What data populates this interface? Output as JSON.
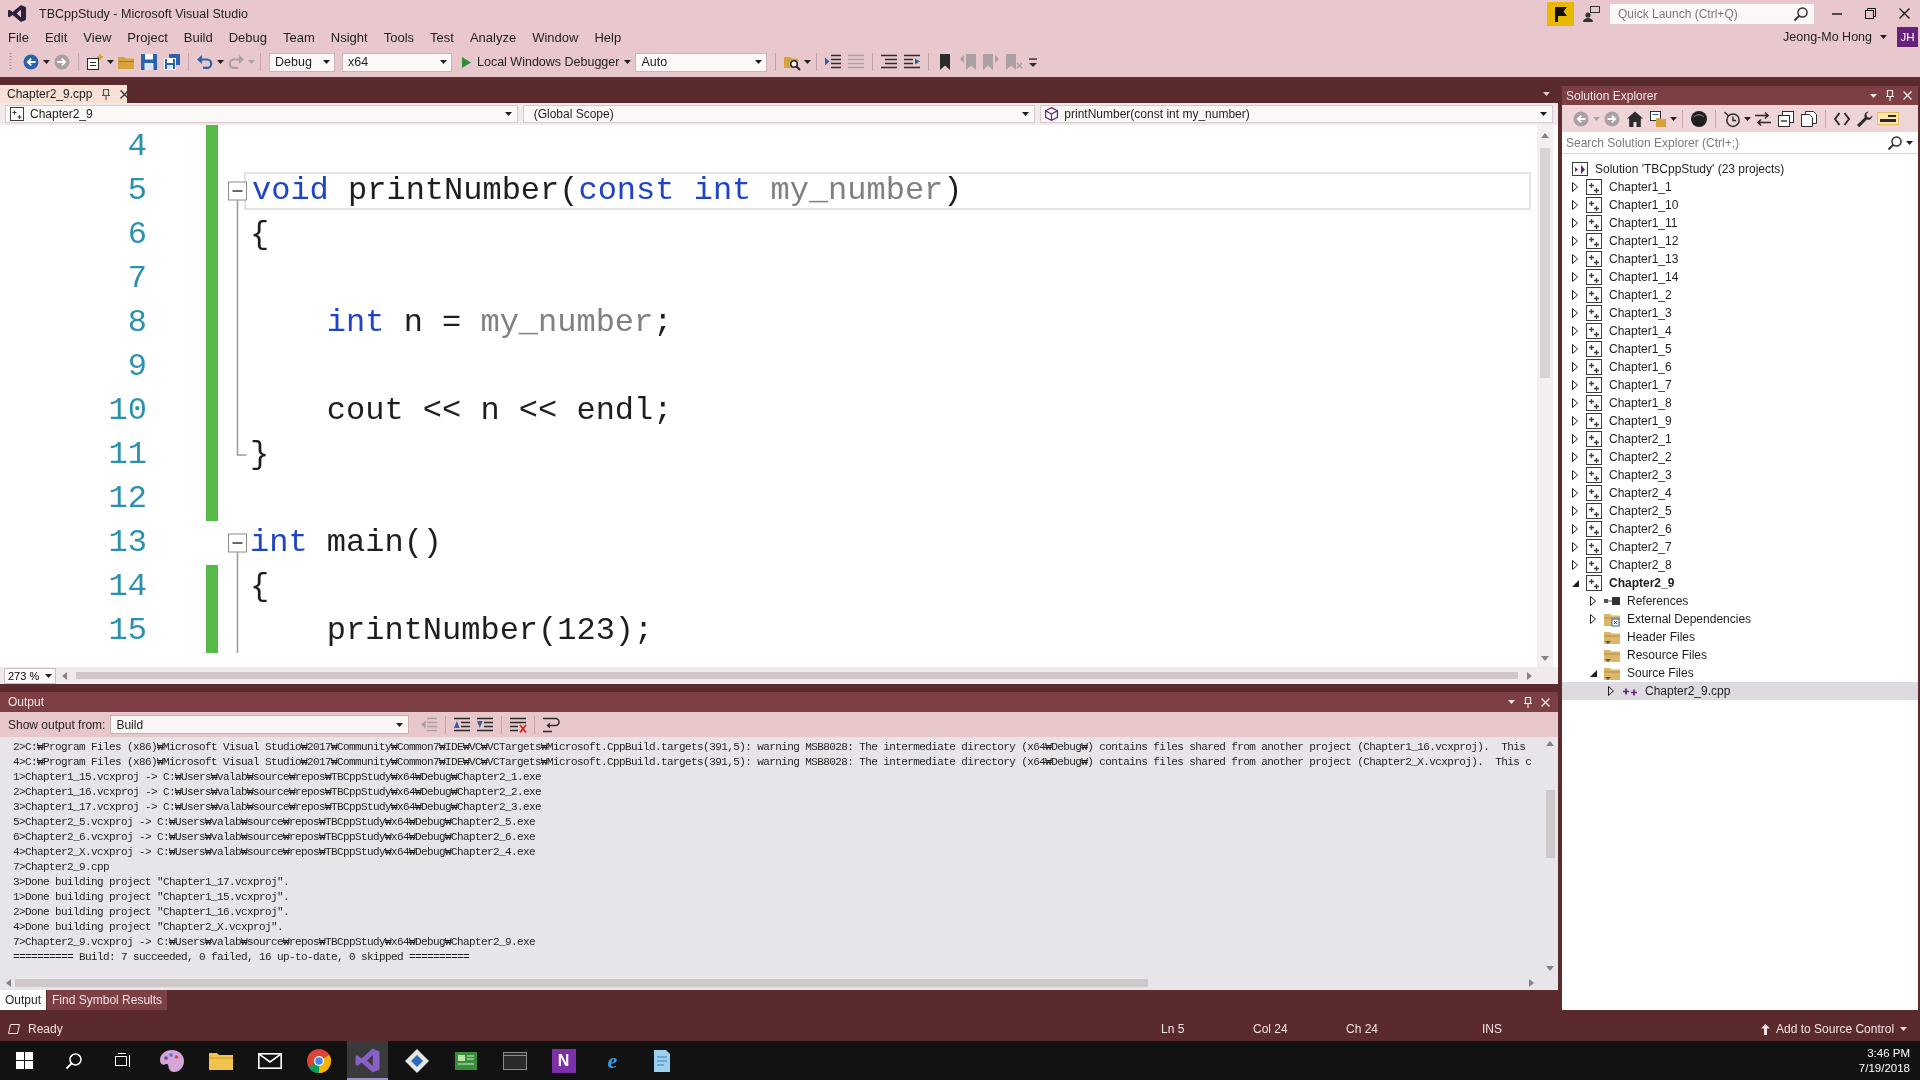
{
  "window": {
    "title": "TBCppStudy - Microsoft Visual Studio",
    "quick_launch": {
      "placeholder": "Quick Launch (Ctrl+Q)"
    },
    "user": {
      "name": "Jeong-Mo Hong",
      "initials": "JH"
    }
  },
  "menu": [
    "File",
    "Edit",
    "View",
    "Project",
    "Build",
    "Debug",
    "Team",
    "Nsight",
    "Tools",
    "Test",
    "Analyze",
    "Window",
    "Help"
  ],
  "toolbar": {
    "groups": [
      [
        {
          "kind": "back",
          "disabled": false
        },
        {
          "kind": "forward",
          "disabled": true
        }
      ],
      [
        {
          "kind": "new-project",
          "disabled": false
        },
        {
          "kind": "open-file",
          "disabled": false
        },
        {
          "kind": "save",
          "disabled": false
        },
        {
          "kind": "save-all",
          "disabled": false
        }
      ],
      [
        {
          "kind": "undo",
          "disabled": false
        },
        {
          "kind": "redo",
          "disabled": true
        }
      ],
      [
        {
          "kind": "combo",
          "value": "Debug"
        },
        {
          "kind": "combo",
          "value": "x64"
        },
        {
          "kind": "run",
          "label": "Local Windows Debugger"
        },
        {
          "kind": "combo",
          "value": "Auto"
        }
      ],
      [
        {
          "kind": "find-in-files",
          "disabled": false
        }
      ],
      [
        {
          "kind": "go-to-line",
          "disabled": false
        },
        {
          "kind": "line-list",
          "disabled": true
        }
      ],
      [
        {
          "kind": "comment",
          "disabled": false
        },
        {
          "kind": "uncomment",
          "disabled": false
        }
      ],
      [
        {
          "kind": "bookmark",
          "disabled": false
        },
        {
          "kind": "bookmark-previous",
          "disabled": true
        },
        {
          "kind": "bookmark-next",
          "disabled": true
        },
        {
          "kind": "bookmark-clear",
          "disabled": true
        },
        {
          "kind": "overflow",
          "disabled": false
        }
      ]
    ]
  },
  "editor": {
    "tabs": [
      {
        "label": "Chapter2_9.cpp",
        "selected": true
      }
    ],
    "navigation": {
      "project": "Chapter2_9",
      "scope": "(Global Scope)",
      "member": "printNumber(const int my_number)"
    },
    "zoom": "273 %",
    "lines": [
      {
        "number": "4",
        "kind": "plain",
        "changed": true,
        "current": false
      },
      {
        "number": "5",
        "kind": "header",
        "expanded": true,
        "tokens": [
          {
            "kind": "keyword",
            "text": "void"
          },
          {
            "kind": "plain",
            "text": " printNumber("
          },
          {
            "kind": "keyword",
            "text": "const int"
          },
          {
            "kind": "parameter",
            "text": " my_number"
          },
          {
            "kind": "plain",
            "text": ")"
          }
        ],
        "changed": true,
        "current": true
      },
      {
        "number": "6",
        "kind": "body",
        "tokens": [
          {
            "kind": "plain",
            "text": "{"
          }
        ],
        "changed": true,
        "current": false
      },
      {
        "number": "7",
        "kind": "body",
        "changed": true,
        "current": false
      },
      {
        "number": "8",
        "kind": "body",
        "tokens": [
          {
            "kind": "keyword",
            "text": "    int"
          },
          {
            "kind": "plain",
            "text": " n = "
          },
          {
            "kind": "parameter",
            "text": "my_number"
          },
          {
            "kind": "plain",
            "text": ";"
          }
        ],
        "changed": true,
        "current": false
      },
      {
        "number": "9",
        "kind": "body",
        "changed": true,
        "current": false
      },
      {
        "number": "10",
        "kind": "body",
        "tokens": [
          {
            "kind": "plain",
            "text": "    cout << n << endl;"
          }
        ],
        "changed": true,
        "current": false
      },
      {
        "number": "11",
        "kind": "footer",
        "tokens": [
          {
            "kind": "plain",
            "text": "}"
          }
        ],
        "changed": true,
        "current": false
      },
      {
        "number": "12",
        "kind": "plain",
        "changed": true,
        "current": false
      },
      {
        "number": "13",
        "kind": "header",
        "expanded": true,
        "tokens": [
          {
            "kind": "keyword",
            "text": "int"
          },
          {
            "kind": "plain",
            "text": " main()"
          }
        ],
        "changed": false,
        "current": false
      },
      {
        "number": "14",
        "kind": "body",
        "tokens": [
          {
            "kind": "plain",
            "text": "{"
          }
        ],
        "changed": true,
        "current": false
      },
      {
        "number": "15",
        "kind": "body",
        "tokens": [
          {
            "kind": "plain",
            "text": "    printNumber(123);"
          }
        ],
        "changed": true,
        "current": false
      }
    ]
  },
  "output": {
    "title": "Output",
    "source_label": "Show output from:",
    "source": "Build",
    "toolbar": [
      [
        {
          "kind": "previous-message",
          "disabled": true
        }
      ],
      [
        {
          "kind": "find-previous",
          "disabled": false
        },
        {
          "kind": "find-next",
          "disabled": false
        }
      ],
      [
        {
          "kind": "clear-all",
          "disabled": false
        }
      ],
      [
        {
          "kind": "word-wrap",
          "disabled": false
        }
      ]
    ],
    "lines": [
      "2>C:₩Program Files (x86)₩Microsoft Visual Studio₩2017₩Community₩Common7₩IDE₩VC₩VCTargets₩Microsoft.CppBuild.targets(391,5): warning MSB8028: The intermediate directory (x64₩Debug₩) contains files shared from another project (Chapter1_16.vcxproj).  This",
      "4>C:₩Program Files (x86)₩Microsoft Visual Studio₩2017₩Community₩Common7₩IDE₩VC₩VCTargets₩Microsoft.CppBuild.targets(391,5): warning MSB8028: The intermediate directory (x64₩Debug₩) contains files shared from another project (Chapter2_X.vcxproj).  This c",
      "1>Chapter1_15.vcxproj -> C:₩Users₩valab₩source₩repos₩TBCppStudy₩x64₩Debug₩Chapter2_1.exe",
      "2>Chapter1_16.vcxproj -> C:₩Users₩valab₩source₩repos₩TBCppStudy₩x64₩Debug₩Chapter2_2.exe",
      "3>Chapter1_17.vcxproj -> C:₩Users₩valab₩source₩repos₩TBCppStudy₩x64₩Debug₩Chapter2_3.exe",
      "5>Chapter2_5.vcxproj -> C:₩Users₩valab₩source₩repos₩TBCppStudy₩x64₩Debug₩Chapter2_5.exe",
      "6>Chapter2_6.vcxproj -> C:₩Users₩valab₩source₩repos₩TBCppStudy₩x64₩Debug₩Chapter2_6.exe",
      "4>Chapter2_X.vcxproj -> C:₩Users₩valab₩source₩repos₩TBCppStudy₩x64₩Debug₩Chapter2_4.exe",
      "7>Chapter2_9.cpp",
      "3>Done building project \"Chapter1_17.vcxproj\".",
      "1>Done building project \"Chapter1_15.vcxproj\".",
      "2>Done building project \"Chapter1_16.vcxproj\".",
      "4>Done building project \"Chapter2_X.vcxproj\".",
      "7>Chapter2_9.vcxproj -> C:₩Users₩valab₩source₩repos₩TBCppStudy₩x64₩Debug₩Chapter2_9.exe",
      "========== Build: 7 succeeded, 0 failed, 16 up-to-date, 0 skipped =========="
    ],
    "tabs": [
      {
        "label": "Output",
        "selected": true
      },
      {
        "label": "Find Symbol Results",
        "selected": false
      }
    ]
  },
  "solution_explorer": {
    "title": "Solution Explorer",
    "toolbar": [
      [
        {
          "kind": "back",
          "disabled": true,
          "on": false
        },
        {
          "kind": "forward",
          "disabled": true,
          "on": false
        },
        {
          "kind": "home",
          "disabled": false,
          "on": false
        },
        {
          "kind": "switch-views",
          "disabled": false,
          "on": false
        }
      ],
      [
        {
          "kind": "pending-changes",
          "disabled": false,
          "on": false
        }
      ],
      [
        {
          "kind": "history",
          "disabled": false,
          "on": false
        },
        {
          "kind": "sync",
          "disabled": false,
          "on": false
        },
        {
          "kind": "collapse-all",
          "disabled": false,
          "on": false
        },
        {
          "kind": "show-all-files",
          "disabled": false,
          "on": false
        }
      ],
      [
        {
          "kind": "code-view",
          "disabled": false,
          "on": false
        },
        {
          "kind": "properties",
          "disabled": false,
          "on": false
        },
        {
          "kind": "preview",
          "disabled": false,
          "on": true
        }
      ]
    ],
    "search": {
      "placeholder": "Search Solution Explorer (Ctrl+;)"
    },
    "tree": [
      {
        "label": "Solution 'TBCppStudy' (23 projects)",
        "kind": "solution",
        "selected": false,
        "children": [
          {
            "label": "Chapter1_1",
            "kind": "project",
            "startup": false,
            "expanded": false,
            "selected": false
          },
          {
            "label": "Chapter1_10",
            "kind": "project",
            "startup": false,
            "expanded": false,
            "selected": false
          },
          {
            "label": "Chapter1_11",
            "kind": "project",
            "startup": false,
            "expanded": false,
            "selected": false
          },
          {
            "label": "Chapter1_12",
            "kind": "project",
            "startup": false,
            "expanded": false,
            "selected": false
          },
          {
            "label": "Chapter1_13",
            "kind": "project",
            "startup": false,
            "expanded": false,
            "selected": false
          },
          {
            "label": "Chapter1_14",
            "kind": "project",
            "startup": false,
            "expanded": false,
            "selected": false
          },
          {
            "label": "Chapter1_2",
            "kind": "project",
            "startup": false,
            "expanded": false,
            "selected": false
          },
          {
            "label": "Chapter1_3",
            "kind": "project",
            "startup": false,
            "expanded": false,
            "selected": false
          },
          {
            "label": "Chapter1_4",
            "kind": "project",
            "startup": false,
            "expanded": false,
            "selected": false
          },
          {
            "label": "Chapter1_5",
            "kind": "project",
            "startup": false,
            "expanded": false,
            "selected": false
          },
          {
            "label": "Chapter1_6",
            "kind": "project",
            "startup": false,
            "expanded": false,
            "selected": false
          },
          {
            "label": "Chapter1_7",
            "kind": "project",
            "startup": false,
            "expanded": false,
            "selected": false
          },
          {
            "label": "Chapter1_8",
            "kind": "project",
            "startup": false,
            "expanded": false,
            "selected": false
          },
          {
            "label": "Chapter1_9",
            "kind": "project",
            "startup": false,
            "expanded": false,
            "selected": false
          },
          {
            "label": "Chapter2_1",
            "kind": "project",
            "startup": false,
            "expanded": false,
            "selected": false
          },
          {
            "label": "Chapter2_2",
            "kind": "project",
            "startup": false,
            "expanded": false,
            "selected": false
          },
          {
            "label": "Chapter2_3",
            "kind": "project",
            "startup": false,
            "expanded": false,
            "selected": false
          },
          {
            "label": "Chapter2_4",
            "kind": "project",
            "startup": false,
            "expanded": false,
            "selected": false
          },
          {
            "label": "Chapter2_5",
            "kind": "project",
            "startup": false,
            "expanded": false,
            "selected": false
          },
          {
            "label": "Chapter2_6",
            "kind": "project",
            "startup": false,
            "expanded": false,
            "selected": false
          },
          {
            "label": "Chapter2_7",
            "kind": "project",
            "startup": false,
            "expanded": false,
            "selected": false
          },
          {
            "label": "Chapter2_8",
            "kind": "project",
            "startup": false,
            "expanded": false,
            "selected": false
          },
          {
            "label": "Chapter2_9",
            "kind": "project",
            "startup": true,
            "expanded": true,
            "selected": false,
            "children": [
              {
                "label": "References",
                "kind": "references",
                "expanded": false,
                "selected": false
              },
              {
                "label": "External Dependencies",
                "kind": "dependencies",
                "expanded": false,
                "selected": false
              },
              {
                "label": "Header Files",
                "kind": "filter",
                "selected": false
              },
              {
                "label": "Resource Files",
                "kind": "filter",
                "selected": false
              },
              {
                "label": "Source Files",
                "kind": "filter",
                "expanded": true,
                "selected": false,
                "children": [
                  {
                    "label": "Chapter2_9.cpp",
                    "kind": "source",
                    "expanded": false,
                    "selected": true
                  }
                ]
              }
            ]
          }
        ]
      }
    ]
  },
  "status_bar": {
    "message": "Ready",
    "line": "Ln 5",
    "column": "Col 24",
    "character": "Ch 24",
    "mode": "INS",
    "source_control": "Add to Source Control"
  },
  "taskbar": {
    "apps": [
      {
        "kind": "palette",
        "active": false
      },
      {
        "kind": "folder",
        "active": false
      },
      {
        "kind": "mail",
        "active": false
      },
      {
        "kind": "browser",
        "active": false
      },
      {
        "kind": "ide",
        "active": true
      },
      {
        "kind": "diamond",
        "active": false
      },
      {
        "kind": "board",
        "active": false
      },
      {
        "kind": "terminal",
        "active": false
      },
      {
        "kind": "notebook",
        "glyph": "N",
        "active": false
      },
      {
        "kind": "web",
        "glyph": "e",
        "active": false
      },
      {
        "kind": "notepad",
        "active": false
      }
    ],
    "time": "3:46 PM",
    "date": "7/19/2018"
  }
}
